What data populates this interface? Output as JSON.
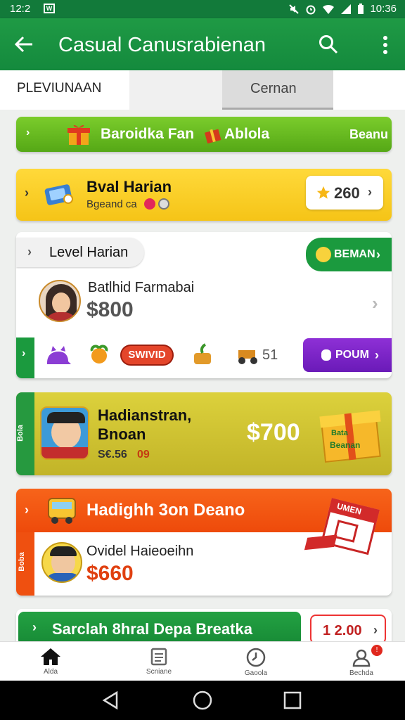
{
  "status": {
    "time": "12:2",
    "clock": "10:36",
    "sim_label": "W"
  },
  "appbar": {
    "title": "Casual Canusrabienan"
  },
  "tabs": [
    {
      "label": "PLEVIUNAAN"
    },
    {
      "label": "Cernan"
    }
  ],
  "promo_banner": {
    "text": "Baroidka Fan",
    "text2": "Ablola",
    "cta": "Beanu"
  },
  "daily_card": {
    "title": "Bval Harian",
    "subtitle": "Bgeand ca",
    "value": "260"
  },
  "level_card": {
    "tag": "Level Harian",
    "badge": "BEMAN",
    "user_name": "Batlhid Farmabai",
    "amount": "$800",
    "pill": "SWIVID",
    "count": "51",
    "button": "POUM"
  },
  "yellow_card": {
    "side": "Bola",
    "title": "Hadianstran,",
    "subtitle": "Bnoan",
    "meta": "S€.56",
    "meta2": "09",
    "amount": "$700",
    "gift_text1": "Bata",
    "gift_text2": "Beanan"
  },
  "orange_card": {
    "side": "Boba",
    "title": "Hadighh 3on Deano",
    "name": "Ovidel Haieoeihn",
    "amount": "$660",
    "sign": "UMEN"
  },
  "green_card": {
    "title": "Sarclah 8hral Depa Breatka",
    "amount": "1 2.00"
  },
  "nav": [
    {
      "label": "Alda"
    },
    {
      "label": "Scniane"
    },
    {
      "label": "Gaoola"
    },
    {
      "label": "Bechda"
    }
  ],
  "colors": {
    "primary": "#16883c",
    "yellow": "#fcd22e",
    "orange": "#f4520e",
    "purple": "#7a1fc7"
  }
}
